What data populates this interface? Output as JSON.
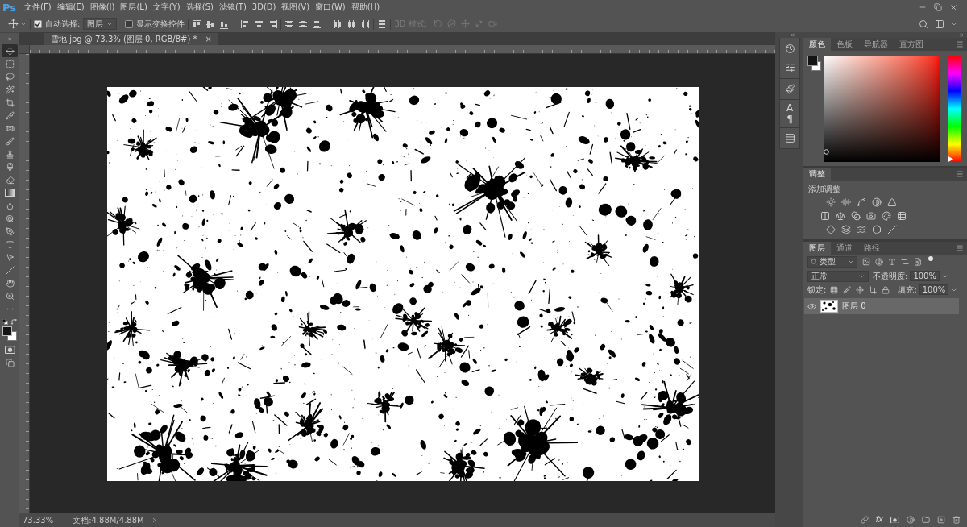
{
  "app": {
    "logo": "Ps"
  },
  "menu": [
    "文件(F)",
    "编辑(E)",
    "图像(I)",
    "图层(L)",
    "文字(Y)",
    "选择(S)",
    "滤镜(T)",
    "3D(D)",
    "视图(V)",
    "窗口(W)",
    "帮助(H)"
  ],
  "options_bar": {
    "auto_select": {
      "label": "自动选择:",
      "checked": true
    },
    "auto_select_target": "图层",
    "transform_controls": {
      "label": "显示变换控件",
      "checked": false
    },
    "mode_3d": {
      "label": "3D 模式:",
      "disabled": true
    }
  },
  "document": {
    "tab": {
      "title": "雪地.jpg @ 73.3% (图层 0, RGB/8#) *",
      "close": "×"
    }
  },
  "tools": [
    {
      "selected": true
    },
    {
      "selected": false
    },
    {
      "selected": false
    },
    {
      "selected": false
    },
    {
      "selected": false
    },
    {
      "selected": false
    },
    {
      "selected": false
    },
    {
      "selected": false
    },
    {
      "selected": false
    },
    {
      "selected": false
    },
    {
      "selected": false
    },
    {
      "selected": false
    },
    {
      "selected": false
    },
    {
      "selected": false
    },
    {
      "selected": false
    },
    {
      "selected": false
    },
    {
      "selected": false
    },
    {
      "selected": false
    },
    {
      "selected": false
    },
    {
      "selected": false
    },
    {
      "selected": false
    }
  ],
  "dock": {
    "character": "A",
    "paragraph": "¶"
  },
  "color_panel": {
    "tabs": [
      {
        "label": "颜色",
        "selected": true
      },
      {
        "label": "色板",
        "selected": false
      },
      {
        "label": "导航器",
        "selected": false
      },
      {
        "label": "直方图",
        "selected": false
      }
    ],
    "hue": {
      "level": 0
    }
  },
  "adjustments_panel": {
    "tabs": [
      {
        "label": "调整",
        "selected": true
      }
    ],
    "hint": "添加调整"
  },
  "layers_panel": {
    "tabs": [
      {
        "label": "图层",
        "selected": true
      },
      {
        "label": "通道",
        "selected": false
      },
      {
        "label": "路径",
        "selected": false
      }
    ],
    "filter": "类型",
    "blend_mode": "正常",
    "opacity": {
      "label": "不透明度:",
      "value": "100%"
    },
    "lock_label": "锁定:",
    "fill": {
      "label": "填充:",
      "value": "100%"
    },
    "layers": [
      {
        "name": "图层 0",
        "visible": true,
        "selected": true
      }
    ],
    "footer_fx": "fx"
  },
  "status_bar": {
    "zoom": "73.33%",
    "doc_info": "文档:4.88M/4.88M"
  }
}
